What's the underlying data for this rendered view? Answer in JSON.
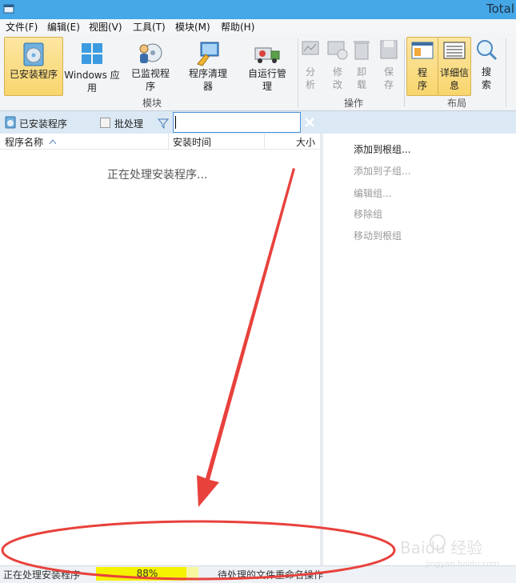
{
  "window": {
    "title": "Total"
  },
  "menu": [
    "文件(F)",
    "编辑(E)",
    "视图(V)",
    "工具(T)",
    "模块(M)",
    "帮助(H)"
  ],
  "ribbon": {
    "modules": {
      "label": "模块",
      "installed": "已安装程序",
      "windows_apps": "Windows 应用",
      "monitored": "已监视程序",
      "cleaner": "程序清理器",
      "autorun": "自运行管理"
    },
    "actions": {
      "label": "操作",
      "analyze": "分析",
      "modify": "修改",
      "uninstall": "卸载",
      "save": "保存"
    },
    "layout": {
      "label": "布局",
      "programs": "程序",
      "details": "详细信息",
      "search": "搜索"
    }
  },
  "toolbar": {
    "installed_tab": "已安装程序",
    "batch_label": "批处理",
    "search_value": ""
  },
  "columns": {
    "name": "程序名称",
    "install_date": "安装时间",
    "size": "大小"
  },
  "list": {
    "processing_message": "正在处理安装程序..."
  },
  "right_pane": {
    "add_to_root_group": "添加到根组...",
    "add_to_subgroup": "添加到子组...",
    "edit_group": "编辑组...",
    "remove_group": "移除组",
    "move_to_root_group": "移动到根组"
  },
  "status": {
    "left": "正在处理安装程序",
    "progress_percent": 88,
    "progress_label": "88%",
    "right": "待处理的文件重命名操作"
  },
  "watermark": {
    "text": "Baidu 经验",
    "url": "jingyan.baidu.com"
  },
  "colors": {
    "titlebar": "#45a7e6",
    "annotation": "#e8413c",
    "progress": "#f5f200"
  },
  "icons": [
    "app-icon",
    "cd-installer-icon",
    "windows-logo-icon",
    "monitor-cd-icon",
    "broom-screen-icon",
    "truck-icon",
    "chart-icon",
    "modify-icon",
    "recycle-bin-icon",
    "floppy-icon",
    "list-view-icon",
    "details-grid-icon",
    "magnifier-icon",
    "filter-icon",
    "clear-icon",
    "sort-up-icon",
    "paw-icon"
  ]
}
